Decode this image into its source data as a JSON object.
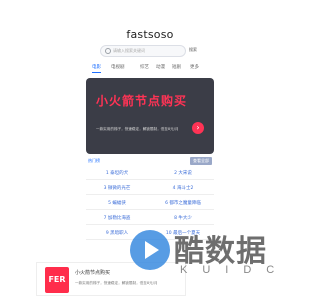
{
  "header": {
    "logo": "fastsoso"
  },
  "search": {
    "placeholder": "请输入搜索关键词",
    "button": "搜索"
  },
  "tabs": [
    {
      "label": "电影",
      "active": true
    },
    {
      "label": "电视剧",
      "active": false
    },
    {
      "label": "综艺",
      "active": false
    },
    {
      "label": "动漫",
      "active": false
    },
    {
      "label": "短剧",
      "active": false
    },
    {
      "label": "更多",
      "active": false
    }
  ],
  "banner": {
    "headline": "小火箭节点购买",
    "subtext": "一款实用的梯子，快速稳定，解锁限制，低至8元/月",
    "bg_color": "#3b3d47",
    "accent_color": "#ff3355"
  },
  "list": {
    "left_label": "热门榜",
    "right_label": "查看全部",
    "items": [
      [
        "1 泰坦的犬",
        "2 大宋说"
      ],
      [
        "3 微微的光芒",
        "4 海斗士2"
      ],
      [
        "5 蝙蝠侠",
        "6 都市之魔童降临"
      ],
      [
        "7 加勒比海盗",
        "8 牛大少"
      ],
      [
        "9 黑暗职人",
        "10 最后一个夏天"
      ]
    ]
  },
  "ad": {
    "logo_text": "FER",
    "title": "小火箭节点购买",
    "desc": "一款实用的梯子，快速稳定，解锁限制，低至8元/月"
  },
  "watermark": {
    "cn": "酷数据",
    "en": "KUIDC"
  }
}
